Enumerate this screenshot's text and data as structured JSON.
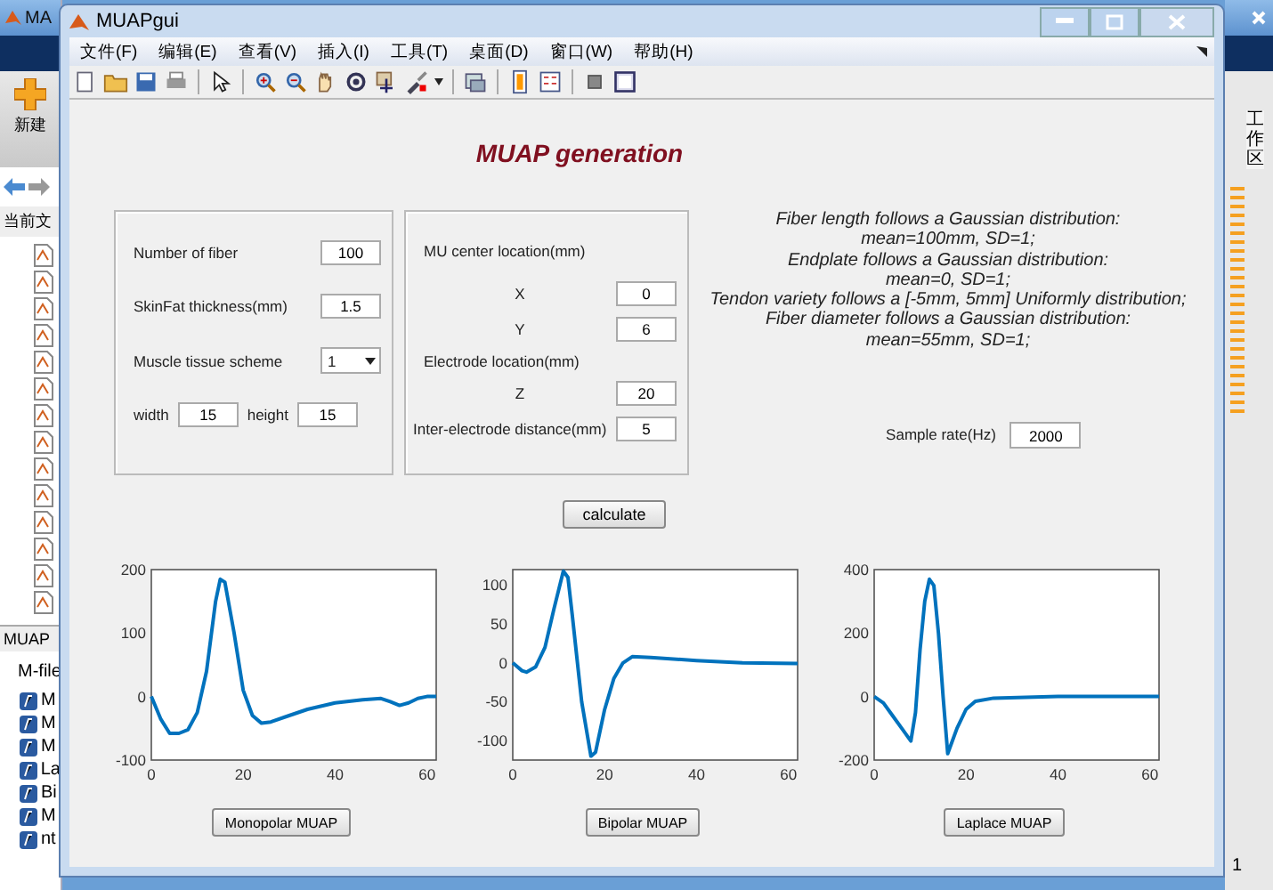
{
  "backdrop": {
    "title": "MA",
    "new_button": "新建",
    "folder_label": "当前文",
    "details_tab": "MUAP",
    "details_label": "M-file",
    "file_letters": [
      "M",
      "M",
      "M",
      "La",
      "Bi",
      "M",
      "nt"
    ],
    "workspace_tab": "工作区",
    "status": "1"
  },
  "window": {
    "title": "MUAPgui"
  },
  "menu": [
    "文件(F)",
    "编辑(E)",
    "查看(V)",
    "插入(I)",
    "工具(T)",
    "桌面(D)",
    "窗口(W)",
    "帮助(H)"
  ],
  "heading": "MUAP generation",
  "fiber_panel": {
    "fiber_count": {
      "label": "Number of fiber",
      "value": "100"
    },
    "skinfat": {
      "label": "SkinFat thickness(mm)",
      "value": "1.5"
    },
    "scheme": {
      "label": "Muscle tissue scheme",
      "value": "1"
    },
    "width": {
      "label": "width",
      "value": "15"
    },
    "height": {
      "label": "height",
      "value": "15"
    }
  },
  "location_panel": {
    "mu_heading": "MU center location(mm)",
    "x": {
      "label": "X",
      "value": "0"
    },
    "y": {
      "label": "Y",
      "value": "6"
    },
    "electrode_heading": "Electrode location(mm)",
    "z": {
      "label": "Z",
      "value": "20"
    },
    "distance": {
      "label": "Inter-electrode distance(mm)",
      "value": "5"
    }
  },
  "description": [
    "Fiber length follows a Gaussian distribution:",
    "mean=100mm, SD=1;",
    "Endplate follows a Gaussian distribution:",
    "mean=0, SD=1;",
    "Tendon variety follows a [-5mm, 5mm] Uniformly distribution;",
    "Fiber diameter follows a Gaussian distribution:",
    "mean=55mm, SD=1;"
  ],
  "sample_rate": {
    "label": "Sample rate(Hz)",
    "value": "2000"
  },
  "calculate_button": "calculate",
  "plots": [
    {
      "button": "Monopolar MUAP",
      "chart_data": {
        "type": "line",
        "x": [
          0,
          2,
          4,
          6,
          8,
          10,
          12,
          14,
          15,
          16,
          18,
          20,
          22,
          24,
          26,
          30,
          34,
          40,
          46,
          50,
          52,
          54,
          56,
          58,
          60,
          62
        ],
        "series": [
          {
            "color": "#0072bd",
            "values": [
              0,
              -35,
              -58,
              -58,
              -52,
              -25,
              40,
              150,
              185,
              180,
              100,
              10,
              -30,
              -42,
              -40,
              -30,
              -20,
              -10,
              -5,
              -3,
              -8,
              -14,
              -10,
              -3,
              0,
              0
            ]
          }
        ],
        "xlim": [
          0,
          62
        ],
        "ylim": [
          -100,
          200
        ],
        "xticks": [
          0,
          20,
          40,
          60
        ],
        "yticks": [
          -100,
          0,
          100,
          200
        ]
      }
    },
    {
      "button": "Bipolar MUAP",
      "chart_data": {
        "type": "line",
        "x": [
          0,
          2,
          3,
          5,
          7,
          9,
          11,
          12,
          13,
          15,
          17,
          18,
          20,
          22,
          24,
          26,
          30,
          40,
          50,
          62
        ],
        "series": [
          {
            "color": "#0072bd",
            "values": [
              0,
              -10,
              -12,
              -5,
              20,
              70,
              118,
              110,
              60,
              -50,
              -120,
              -115,
              -60,
              -20,
              0,
              8,
              7,
              3,
              0,
              -1
            ]
          }
        ],
        "xlim": [
          0,
          62
        ],
        "ylim": [
          -125,
          120
        ],
        "xticks": [
          0,
          20,
          40,
          60
        ],
        "yticks": [
          -100,
          -50,
          0,
          50,
          100
        ]
      }
    },
    {
      "button": "Laplace MUAP",
      "chart_data": {
        "type": "line",
        "x": [
          0,
          2,
          4,
          6,
          8,
          9,
          10,
          11,
          12,
          13,
          14,
          15,
          16,
          18,
          20,
          22,
          26,
          40,
          62
        ],
        "series": [
          {
            "color": "#0072bd",
            "values": [
              0,
              -20,
              -60,
              -100,
              -140,
              -50,
              150,
              300,
              370,
              350,
              200,
              0,
              -180,
              -100,
              -40,
              -15,
              -5,
              0,
              0
            ]
          }
        ],
        "xlim": [
          0,
          62
        ],
        "ylim": [
          -200,
          400
        ],
        "xticks": [
          0,
          20,
          40,
          60
        ],
        "yticks": [
          -200,
          0,
          200,
          400
        ]
      }
    }
  ]
}
